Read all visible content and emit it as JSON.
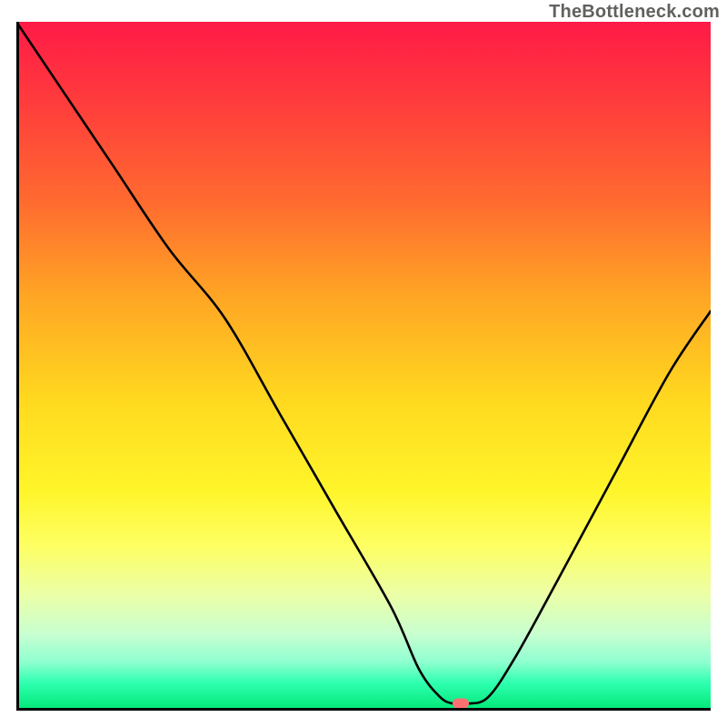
{
  "attribution": "TheBottleneck.com",
  "colors": {
    "gradient_top": "#ff1a47",
    "gradient_bottom": "#00e774",
    "curve": "#000000",
    "marker": "#ff7073",
    "frame": "#000000"
  },
  "chart_data": {
    "type": "line",
    "title": "",
    "xlabel": "",
    "ylabel": "",
    "xlim": [
      0,
      100
    ],
    "ylim": [
      0,
      100
    ],
    "series": [
      {
        "name": "bottleneck-curve",
        "x": [
          0,
          6,
          14,
          22,
          30,
          38,
          46,
          54,
          58,
          61,
          63,
          65,
          68,
          72,
          78,
          86,
          94,
          100
        ],
        "y": [
          100,
          91,
          79,
          67,
          57,
          43,
          29,
          15,
          6,
          2,
          1,
          1,
          2,
          8,
          19,
          34,
          49,
          58
        ]
      }
    ],
    "marker": {
      "x": 64,
      "y": 1
    },
    "annotations": []
  }
}
